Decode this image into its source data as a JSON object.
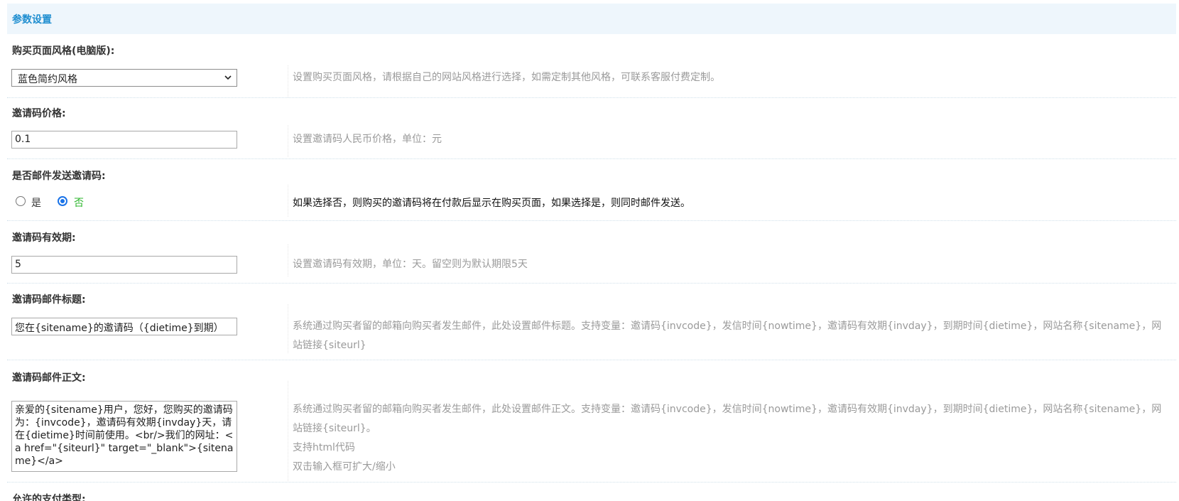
{
  "header": {
    "title": "参数设置"
  },
  "fields": {
    "style": {
      "label": "购买页面风格(电脑版):",
      "value": "蓝色简约风格",
      "help": "设置购买页面风格，请根据自己的网站风格进行选择，如需定制其他风格，可联系客服付费定制。"
    },
    "price": {
      "label": "邀请码价格:",
      "value": "0.1",
      "help": "设置邀请码人民币价格，单位：元"
    },
    "email_send": {
      "label": "是否邮件发送邀请码:",
      "options": [
        "是",
        "否"
      ],
      "selected": "否",
      "help": "如果选择否，则购买的邀请码将在付款后显示在购买页面，如果选择是，则同时邮件发送。"
    },
    "validity": {
      "label": "邀请码有效期:",
      "value": "5",
      "help": "设置邀请码有效期，单位：天。留空则为默认期限5天"
    },
    "mail_title": {
      "label": "邀请码邮件标题:",
      "value": "您在{sitename}的邀请码（{dietime}到期）",
      "help": "系统通过购买者留的邮箱向购买者发生邮件，此处设置邮件标题。支持变量：邀请码{invcode}，发信时间{nowtime}，邀请码有效期{invday}，到期时间{dietime}，网站名称{sitename}，网站链接{siteurl}"
    },
    "mail_body": {
      "label": "邀请码邮件正文:",
      "value": "亲爱的{sitename}用户，您好，您购买的邀请码为：{invcode}，邀请码有效期{invday}天，请在{dietime}时间前使用。<br/>我们的网址：<a href=\"{siteurl}\" target=\"_blank\">{sitename}</a>",
      "help": "系统通过购买者留的邮箱向购买者发生邮件，此处设置邮件正文。支持变量：邀请码{invcode}，发信时间{nowtime}，邀请码有效期{invday}，到期时间{dietime}，网站名称{sitename}，网站链接{siteurl}。",
      "help2": "支持html代码",
      "help3": "双击输入框可扩大/缩小"
    },
    "payment": {
      "label": "允许的支付类型:"
    }
  }
}
